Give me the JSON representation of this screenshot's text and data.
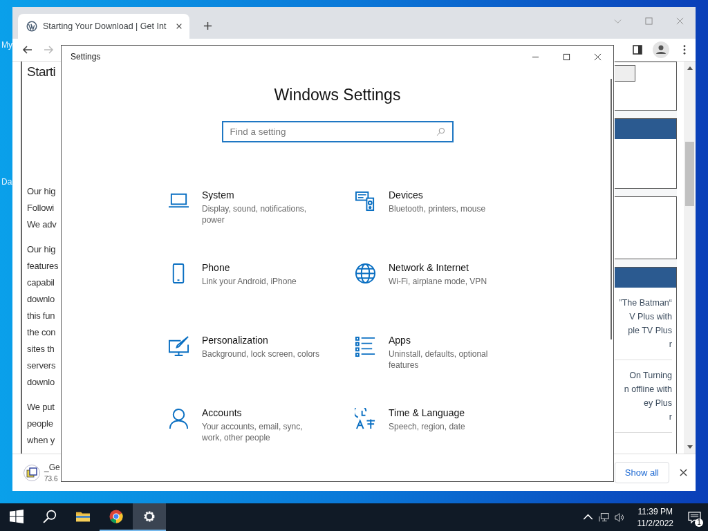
{
  "desktop": {
    "icon_labels": [
      "My",
      "Da"
    ]
  },
  "browser": {
    "tab": {
      "title": "Starting Your Download | Get Int",
      "selected": true
    },
    "article": {
      "heading": "Starti",
      "paragraphs": [
        [
          "Our hig",
          "Followi",
          "We adv"
        ],
        [
          "Our hig",
          "features",
          "capabil",
          "downlo",
          "this fun",
          "the con",
          "sites th",
          "servers",
          "downlo"
        ],
        [
          "We put",
          "people",
          "when y"
        ]
      ]
    },
    "sidebar": {
      "widgets": [
        {
          "kind": "input"
        },
        {
          "kind": "header"
        },
        {
          "kind": "plain"
        },
        {
          "kind": "list",
          "entries": [
            [
              "“The Batman”",
              "V Plus with",
              "ple TV Plus",
              "r"
            ],
            [
              "On Turning",
              "n offline with",
              "ey Plus",
              "r"
            ]
          ]
        }
      ]
    },
    "download": {
      "file_name": "_Ge",
      "file_size": "73.6",
      "show_all": "Show all"
    }
  },
  "settings": {
    "window_title": "Settings",
    "heading": "Windows Settings",
    "search": {
      "placeholder": "Find a setting"
    },
    "categories": [
      {
        "kind": "system",
        "title": "System",
        "description": "Display, sound, notifications, power"
      },
      {
        "kind": "devices",
        "title": "Devices",
        "description": "Bluetooth, printers, mouse"
      },
      {
        "kind": "phone",
        "title": "Phone",
        "description": "Link your Android, iPhone"
      },
      {
        "kind": "network",
        "title": "Network & Internet",
        "description": "Wi-Fi, airplane mode, VPN"
      },
      {
        "kind": "personalization",
        "title": "Personalization",
        "description": "Background, lock screen, colors"
      },
      {
        "kind": "apps",
        "title": "Apps",
        "description": "Uninstall, defaults, optional features"
      },
      {
        "kind": "accounts",
        "title": "Accounts",
        "description": "Your accounts, email, sync, work, other people"
      },
      {
        "kind": "time",
        "title": "Time & Language",
        "description": "Speech, region, date"
      }
    ]
  },
  "taskbar": {
    "apps": [
      {
        "kind": "start",
        "selected": false
      },
      {
        "kind": "search",
        "selected": false
      },
      {
        "kind": "explorer",
        "selected": false
      },
      {
        "kind": "chrome",
        "selected": false
      },
      {
        "kind": "settings",
        "selected": true
      }
    ],
    "time": "11:39 PM",
    "date": "11/2/2022",
    "notification_count": "1"
  }
}
